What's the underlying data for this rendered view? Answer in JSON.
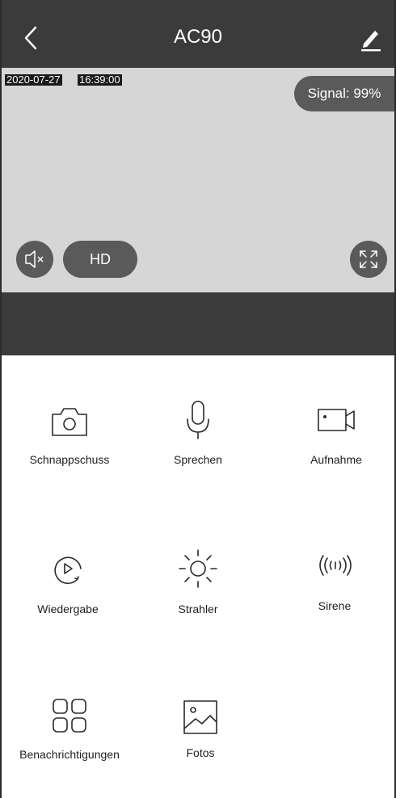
{
  "header": {
    "title": "AC90",
    "back_icon": "chevron-left-icon",
    "edit_icon": "pencil-icon"
  },
  "video": {
    "date": "2020-07-27",
    "time": "16:39:00",
    "signal_label": "Signal: 99%",
    "quality_label": "HD",
    "mute_icon": "speaker-muted-icon",
    "fullscreen_icon": "fullscreen-icon"
  },
  "features": [
    {
      "label": "Schnappschuss",
      "icon": "camera-icon"
    },
    {
      "label": "Sprechen",
      "icon": "microphone-icon"
    },
    {
      "label": "Aufnahme",
      "icon": "video-record-icon"
    },
    {
      "label": "Wiedergabe",
      "icon": "playback-icon"
    },
    {
      "label": "Strahler",
      "icon": "sun-icon"
    },
    {
      "label": "Sirene",
      "icon": "siren-icon"
    },
    {
      "label": "Benachrichtigungen",
      "icon": "grid-icon"
    },
    {
      "label": "Fotos",
      "icon": "photo-icon"
    }
  ],
  "colors": {
    "header_bg": "#3b3b3b",
    "video_bg": "#d6d6d6",
    "overlay_button": "#5a5a5a"
  }
}
